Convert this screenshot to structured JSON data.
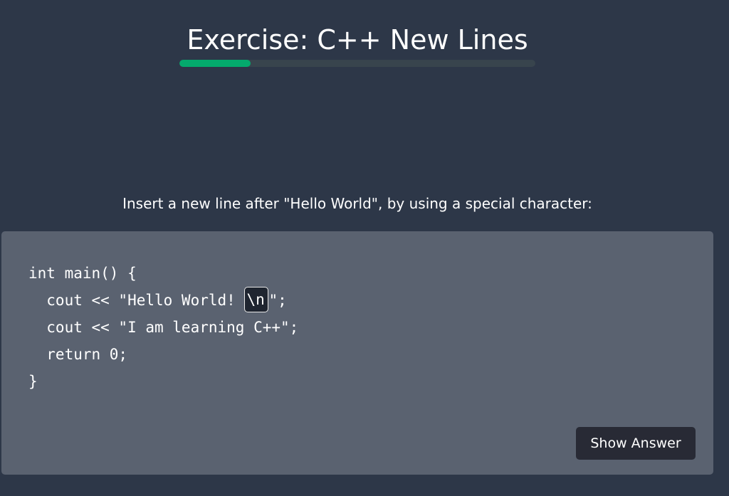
{
  "header": {
    "title": "Exercise: C++ New Lines",
    "progress_fraction": 0.2,
    "progress_color": "#04aa6d"
  },
  "instruction": "Insert a new line after \"Hello World\", by using a special character:",
  "code": {
    "line1": "int main() {",
    "line2_before": "  cout << \"Hello World! ",
    "line2_input_value": "\\n",
    "line2_after": "\";",
    "line3": "  cout << \"I am learning C++\";",
    "line4": "  return 0;",
    "line5": "}"
  },
  "buttons": {
    "show_answer": "Show Answer"
  }
}
